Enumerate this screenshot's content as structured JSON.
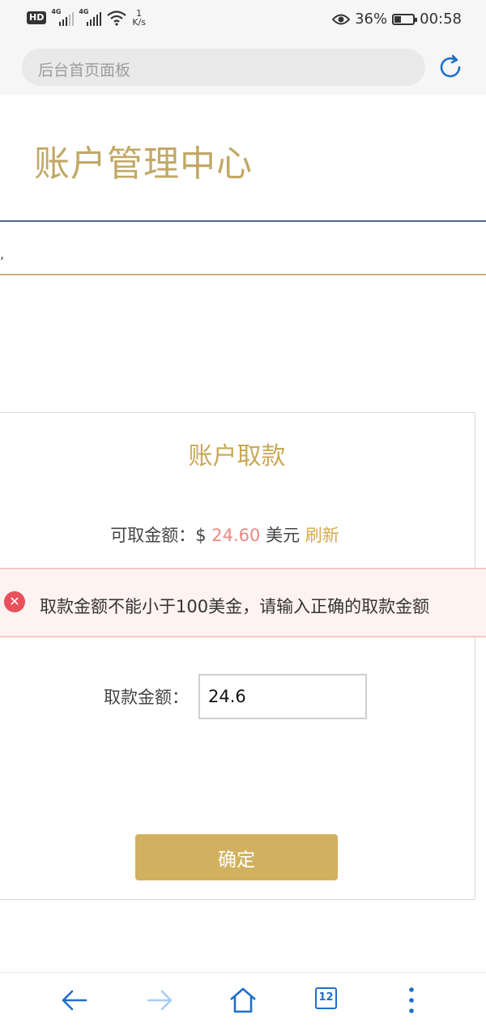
{
  "status_bar": {
    "network_1": "4G",
    "network_2": "4G",
    "speed_value": "1",
    "speed_unit": "K/s",
    "battery_percent": "36%",
    "battery_level": 0.36,
    "time": "00:58"
  },
  "browser": {
    "url_text": "后台首页面板",
    "open_tabs": "12"
  },
  "page": {
    "title": "账户管理中心",
    "nav_fragment": ","
  },
  "withdraw": {
    "card_title": "账户取款",
    "available_label": "可取金额：",
    "currency_symbol": "$ ",
    "available_amount": "24.60",
    "available_unit": " 美元 ",
    "refresh_label": "刷新",
    "error_message": "取款金额不能小于100美金，请输入正确的取款金额",
    "amount_label": "取款金额：",
    "amount_value": "24.6",
    "confirm_label": "确定"
  },
  "colors": {
    "accent_gold": "#c9a857",
    "button_gold": "#d1b15f",
    "amount_pink": "#e88a82",
    "error_red": "#e8505b",
    "nav_blue": "#1e6fc9"
  },
  "icons": [
    "signal-icon",
    "wifi-icon",
    "eye-icon",
    "battery-icon",
    "reload-icon",
    "back-arrow-icon",
    "forward-arrow-icon",
    "home-icon",
    "tabs-icon",
    "more-menu-icon",
    "error-icon"
  ]
}
